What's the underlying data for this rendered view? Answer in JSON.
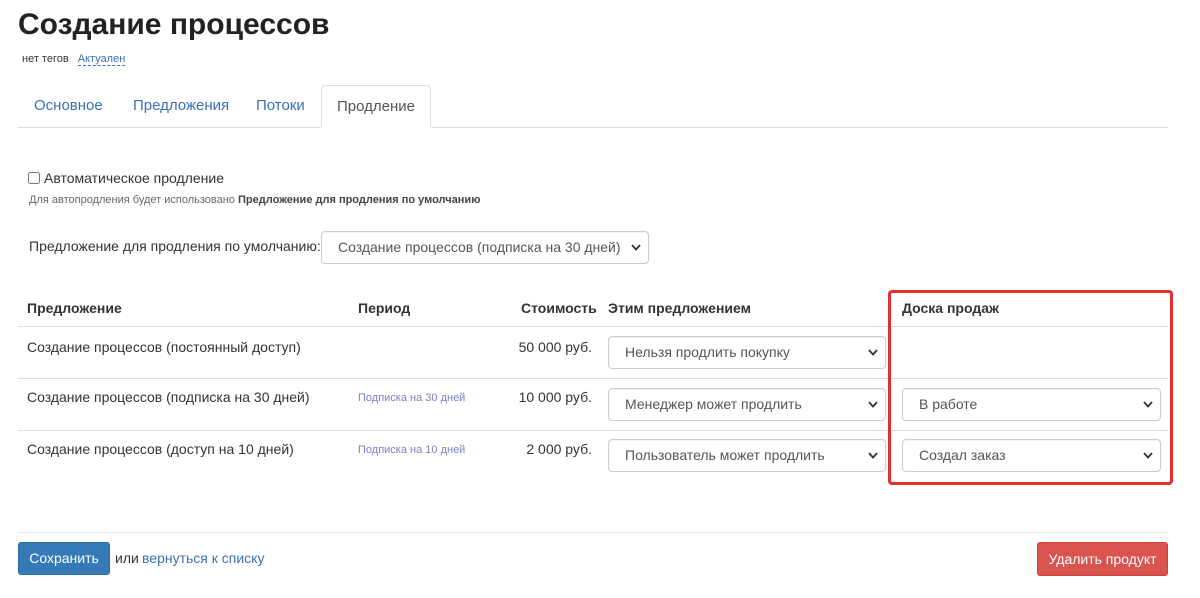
{
  "page": {
    "title": "Создание процессов",
    "tag": "нет тегов",
    "status": "Актуален"
  },
  "tabs": [
    {
      "label": "Основное"
    },
    {
      "label": "Предложения"
    },
    {
      "label": "Потоки"
    },
    {
      "label": "Продление"
    }
  ],
  "active_tab": "Продление",
  "auto_renewal": {
    "checked": false,
    "label": "Автоматическое продление",
    "help_prefix": "Для автопродления будет использовано",
    "help_bold": "Предложение для продления по умолчанию"
  },
  "default_offer": {
    "label": "Предложение для продления по умолчанию:",
    "value": "Создание процессов (подписка на 30 дней)"
  },
  "table": {
    "headers": {
      "offer": "Предложение",
      "period": "Период",
      "price": "Стоимость",
      "action": "Этим предложением",
      "board": "Доска продаж"
    },
    "rows": [
      {
        "offer": "Создание процессов (постоянный доступ)",
        "period": "",
        "price": "50 000 руб.",
        "action": "Нельзя продлить покупку",
        "board": ""
      },
      {
        "offer": "Создание процессов (подписка на 30 дней)",
        "period": "Подписка на 30 дней",
        "price": "10 000 руб.",
        "action": "Менеджер может продлить",
        "board": "В работе"
      },
      {
        "offer": "Создание процессов (доступ на 10 дней)",
        "period": "Подписка на 10 дней",
        "price": "2 000 руб.",
        "action": "Пользователь может продлить",
        "board": "Создал заказ"
      }
    ]
  },
  "footer": {
    "save": "Сохранить",
    "or": "или",
    "back": "вернуться к списку",
    "delete": "Удалить продукт"
  },
  "colors": {
    "link": "#3c6fb3",
    "primary_button": "#337ab7",
    "danger_button": "#d9534f",
    "highlight_border": "#e03131",
    "period_link": "#7a7fc8"
  }
}
